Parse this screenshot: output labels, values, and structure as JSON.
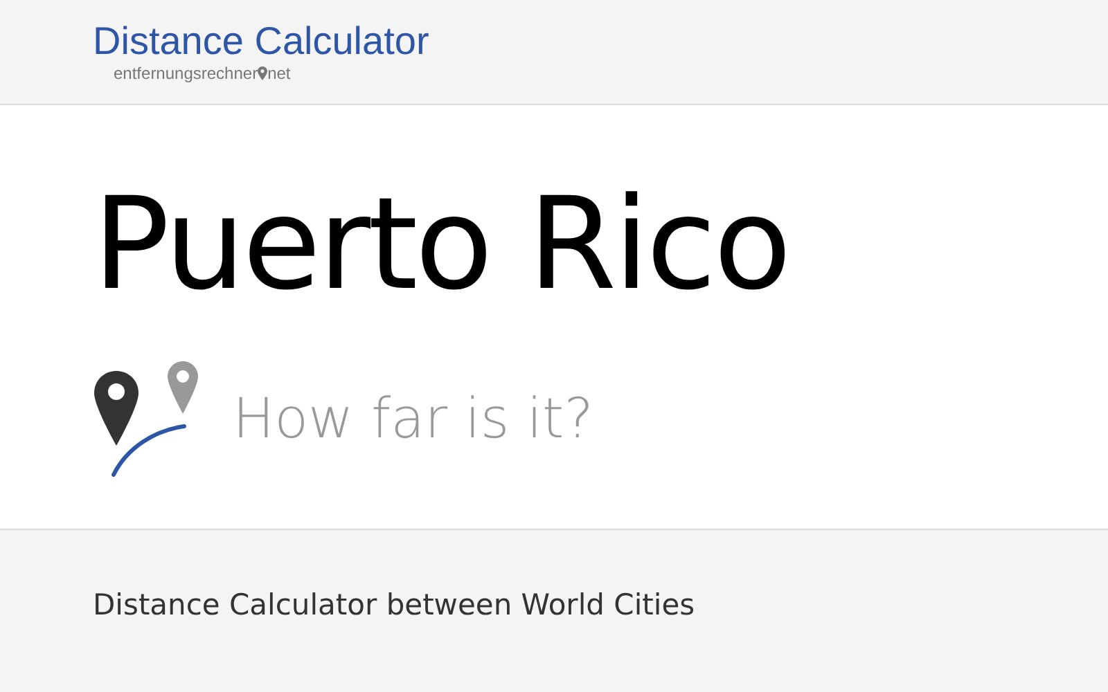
{
  "header": {
    "logo_title": "Distance Calculator",
    "logo_subtitle_parts": [
      "entfernungsrechner",
      "net"
    ]
  },
  "hero": {
    "title": "Puerto Rico",
    "subtitle": "How far is it?"
  },
  "footer_section": {
    "text": "Distance Calculator between World Cities"
  }
}
